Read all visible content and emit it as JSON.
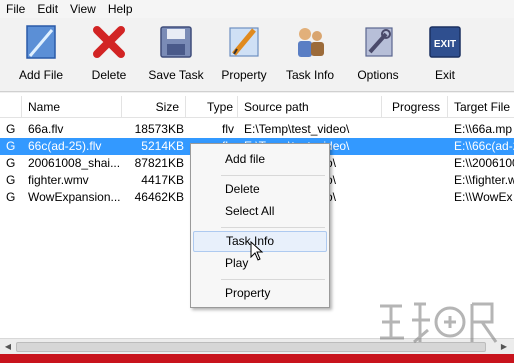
{
  "menubar": {
    "items": [
      "File",
      "Edit",
      "View",
      "Help"
    ]
  },
  "toolbar": {
    "buttons": [
      {
        "label": "Add File",
        "icon": "add-file-icon"
      },
      {
        "label": "Delete",
        "icon": "delete-x-icon"
      },
      {
        "label": "Save Task",
        "icon": "floppy-disk-icon"
      },
      {
        "label": "Property",
        "icon": "pencil-ruler-icon"
      },
      {
        "label": "Task Info",
        "icon": "people-info-icon"
      },
      {
        "label": "Options",
        "icon": "tools-icon"
      },
      {
        "label": "Exit",
        "icon": "exit-door-icon"
      }
    ]
  },
  "table": {
    "columns": [
      "",
      "Name",
      "Size",
      "Type",
      "Source path",
      "Progress",
      "Target File"
    ],
    "rows": [
      {
        "status": "G",
        "name": "66a.flv",
        "size": "18573KB",
        "type": "flv",
        "source": "E:\\Temp\\test_video\\",
        "progress": "",
        "target": "E:\\\\66a.mp"
      },
      {
        "status": "G",
        "name": "66c(ad-25).flv",
        "size": "5214KB",
        "type": "flv",
        "source": "E:\\Temp\\test_video\\",
        "progress": "",
        "target": "E:\\\\66c(ad-25"
      },
      {
        "status": "G",
        "name": "20061008_shai...",
        "size": "87821KB",
        "type": "",
        "source": "o\\",
        "progress": "",
        "target": "E:\\\\2006100"
      },
      {
        "status": "G",
        "name": "fighter.wmv",
        "size": "4417KB",
        "type": "",
        "source": "o\\",
        "progress": "",
        "target": "E:\\\\fighter.w"
      },
      {
        "status": "G",
        "name": "WowExpansion...",
        "size": "46462KB",
        "type": "",
        "source": "o\\",
        "progress": "",
        "target": "E:\\\\WowEx"
      }
    ],
    "selected_row": 1
  },
  "context_menu": {
    "items": [
      "Add file",
      "Delete",
      "Select All",
      "Task Info",
      "Play",
      "Property"
    ],
    "highlighted": "Task Info"
  },
  "colors": {
    "selection": "#3399ff",
    "status_bar": "#c8131c",
    "menu_hover": "#e8f0fb"
  }
}
